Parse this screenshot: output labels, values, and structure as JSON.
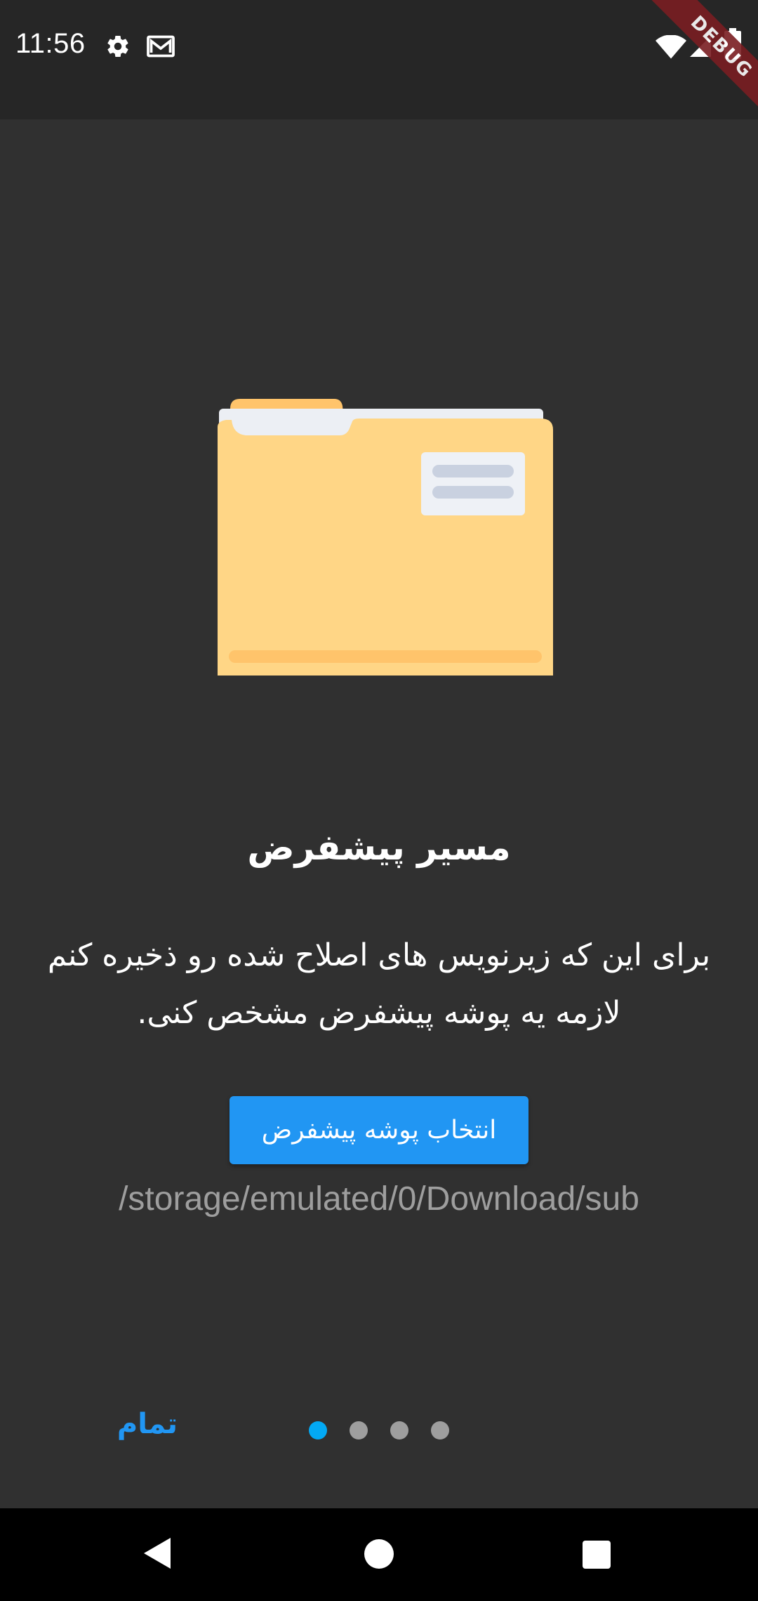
{
  "status_bar": {
    "time": "11:56",
    "icons": [
      "gear-icon",
      "gmail-icon",
      "wifi-icon",
      "cell-signal-icon",
      "battery-icon"
    ],
    "debug_label": "DEBUG"
  },
  "onboarding": {
    "illustration": "folder-icon",
    "title": "مسیر پیشفرض",
    "description_line1": "برای این که زیرنویس های اصلاح شده رو ذخیره کنم",
    "description_line2": "لازمه یه پوشه پیشفرض مشخص کنی.",
    "choose_folder_label": "انتخاب پوشه پیشفرض",
    "folder_path": "/storage/emulated/0/Download/sub"
  },
  "pager": {
    "done_label": "تمام",
    "page_count": 4,
    "current_page": 1
  },
  "navigation": {
    "icons": [
      "back-icon",
      "home-icon",
      "recents-icon"
    ]
  },
  "colors": {
    "accent": "#2196f3",
    "dot_active": "#03a9f4",
    "dot_inactive": "#9e9e9e",
    "background": "#303030",
    "status_bar": "#262626",
    "debug_ribbon": "#7a1e22"
  }
}
